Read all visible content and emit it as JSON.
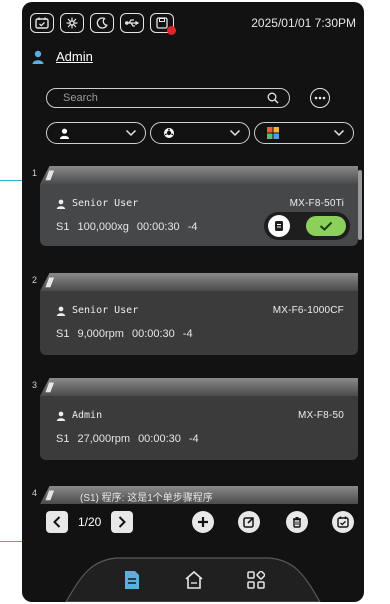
{
  "colors": {
    "background": "#121212",
    "card": "#3b3b3b",
    "card_selected": "#454749",
    "accent_green": "#8bd05a",
    "alert_red": "#e6222a",
    "nav_active": "#5aaee0",
    "annotation_line": "#2fb5c8"
  },
  "statusbar": {
    "icons": [
      "calendar-icon",
      "snowflake-icon",
      "moon-icon",
      "usb-icon",
      "save-icon"
    ],
    "datetime": "2025/01/01  7:30PM"
  },
  "user": {
    "name": "Admin",
    "icon": "user-icon"
  },
  "search": {
    "placeholder": "Search"
  },
  "filters": [
    {
      "icon": "user-icon",
      "name": "user-filter"
    },
    {
      "icon": "rotor-icon",
      "name": "rotor-filter"
    },
    {
      "icon": "color-grid-icon",
      "name": "color-filter"
    }
  ],
  "list": {
    "items": [
      {
        "index": "1",
        "user": "Senior User",
        "model": "MX-F8-50Ti",
        "step": "S1",
        "speed": "100,000xg",
        "time": "00:00:30",
        "temp": "-4",
        "selected": true
      },
      {
        "index": "2",
        "user": "Senior User",
        "model": "MX-F6-1000CF",
        "step": "S1",
        "speed": "9,000rpm",
        "time": "00:00:30",
        "temp": "-4",
        "selected": false
      },
      {
        "index": "3",
        "user": "Admin",
        "model": "MX-F8-50",
        "step": "S1",
        "speed": "27,000rpm",
        "time": "00:00:30",
        "temp": "-4",
        "selected": false
      }
    ],
    "partial": {
      "index": "4",
      "text": "(S1) 程序: 这是1个单步骤程序"
    }
  },
  "pager": {
    "page_text": "1/20"
  },
  "bottom_nav": {
    "items": [
      "document-icon",
      "home-icon",
      "apps-icon"
    ],
    "active": 0
  }
}
